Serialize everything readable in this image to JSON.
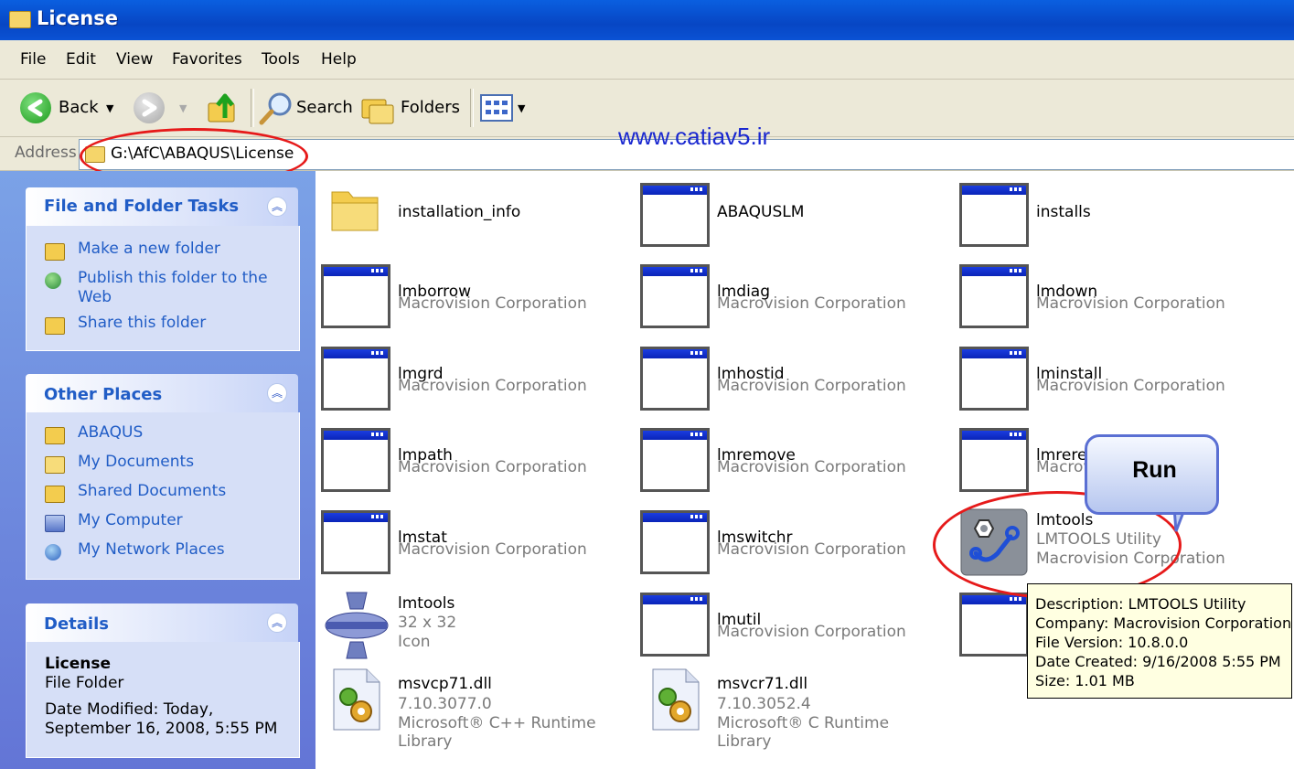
{
  "window": {
    "title": "License"
  },
  "menu": [
    "File",
    "Edit",
    "View",
    "Favorites",
    "Tools",
    "Help"
  ],
  "toolbar": {
    "back": "Back",
    "search": "Search",
    "folders": "Folders"
  },
  "address": {
    "label": "Address",
    "path": "G:\\AfC\\ABAQUS\\License"
  },
  "watermark": "www.catiav5.ir",
  "sidebar": {
    "file_tasks": {
      "title": "File and Folder Tasks",
      "items": [
        {
          "label": "Make a new folder",
          "icon": "new-folder-icon"
        },
        {
          "label": "Publish this folder to the Web",
          "icon": "globe-icon"
        },
        {
          "label": "Share this folder",
          "icon": "share-folder-icon"
        }
      ]
    },
    "other_places": {
      "title": "Other Places",
      "items": [
        {
          "label": "ABAQUS",
          "icon": "folder-icon"
        },
        {
          "label": "My Documents",
          "icon": "documents-icon"
        },
        {
          "label": "Shared Documents",
          "icon": "shared-folder-icon"
        },
        {
          "label": "My Computer",
          "icon": "computer-icon"
        },
        {
          "label": "My Network Places",
          "icon": "network-icon"
        }
      ]
    },
    "details": {
      "title": "Details",
      "name": "License",
      "type": "File Folder",
      "modified_line1": "Date Modified: Today,",
      "modified_line2": "September 16, 2008, 5:55 PM"
    }
  },
  "files": [
    {
      "name": "installation_info",
      "sub1": "",
      "sub2": "",
      "icon": "folder"
    },
    {
      "name": "ABAQUSLM",
      "sub1": "",
      "sub2": "",
      "icon": "app"
    },
    {
      "name": "installs",
      "sub1": "",
      "sub2": "",
      "icon": "app"
    },
    {
      "name": "lmborrow",
      "sub1": "Macrovision Corporation",
      "sub2": "",
      "icon": "app"
    },
    {
      "name": "lmdiag",
      "sub1": "Macrovision Corporation",
      "sub2": "",
      "icon": "app"
    },
    {
      "name": "lmdown",
      "sub1": "Macrovision Corporation",
      "sub2": "",
      "icon": "app"
    },
    {
      "name": "lmgrd",
      "sub1": "Macrovision Corporation",
      "sub2": "",
      "icon": "app"
    },
    {
      "name": "lmhostid",
      "sub1": "Macrovision Corporation",
      "sub2": "",
      "icon": "app"
    },
    {
      "name": "lminstall",
      "sub1": "Macrovision Corporation",
      "sub2": "",
      "icon": "app"
    },
    {
      "name": "lmpath",
      "sub1": "Macrovision Corporation",
      "sub2": "",
      "icon": "app"
    },
    {
      "name": "lmremove",
      "sub1": "Macrovision Corporation",
      "sub2": "",
      "icon": "app"
    },
    {
      "name": "lmrerea",
      "sub1": "Macrov",
      "sub2": "",
      "icon": "app"
    },
    {
      "name": "lmstat",
      "sub1": "Macrovision Corporation",
      "sub2": "",
      "icon": "app"
    },
    {
      "name": "lmswitchr",
      "sub1": "Macrovision Corporation",
      "sub2": "",
      "icon": "app"
    },
    {
      "name": "lmtools",
      "sub1": "LMTOOLS Utility",
      "sub2": "Macrovision Corporation",
      "icon": "lmtools"
    },
    {
      "name": "lmtools",
      "sub1": "32 x 32",
      "sub2": "Icon",
      "icon": "ico"
    },
    {
      "name": "lmutil",
      "sub1": "Macrovision Corporation",
      "sub2": "",
      "icon": "app"
    },
    {
      "name": "",
      "sub1": "",
      "sub2": "",
      "icon": "app"
    },
    {
      "name": "msvcp71.dll",
      "sub1": "7.10.3077.0",
      "sub2": "Microsoft® C++ Runtime Library",
      "icon": "dll"
    },
    {
      "name": "msvcr71.dll",
      "sub1": "7.10.3052.4",
      "sub2": "Microsoft® C Runtime Library",
      "icon": "dll"
    }
  ],
  "callout": "Run",
  "tooltip": [
    "Description: LMTOOLS Utility",
    "Company: Macrovision Corporation",
    "File Version: 10.8.0.0",
    "Date Created: 9/16/2008 5:55 PM",
    "Size: 1.01 MB"
  ]
}
